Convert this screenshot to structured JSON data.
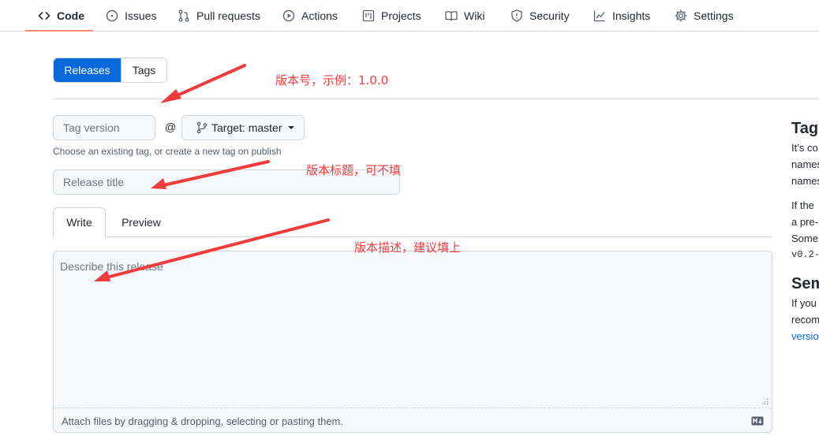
{
  "repo_nav": {
    "items": [
      {
        "id": "code",
        "label": "Code",
        "icon": "code-icon",
        "selected": true
      },
      {
        "id": "issues",
        "label": "Issues",
        "icon": "issue-opened-icon"
      },
      {
        "id": "pulls",
        "label": "Pull requests",
        "icon": "git-pull-request-icon"
      },
      {
        "id": "actions",
        "label": "Actions",
        "icon": "play-icon"
      },
      {
        "id": "projects",
        "label": "Projects",
        "icon": "project-icon"
      },
      {
        "id": "wiki",
        "label": "Wiki",
        "icon": "book-icon"
      },
      {
        "id": "security",
        "label": "Security",
        "icon": "shield-icon"
      },
      {
        "id": "insights",
        "label": "Insights",
        "icon": "graph-icon"
      },
      {
        "id": "settings",
        "label": "Settings",
        "icon": "gear-icon"
      }
    ]
  },
  "subnav": {
    "releases_label": "Releases",
    "tags_label": "Tags"
  },
  "form": {
    "tag_placeholder": "Tag version",
    "at_symbol": "@",
    "target_label": "Target: master",
    "tag_hint": "Choose an existing tag, or create a new tag on publish",
    "title_placeholder": "Release title",
    "write_tab": "Write",
    "preview_tab": "Preview",
    "body_placeholder": "Describe this release",
    "attach_text": "Attach files by dragging & dropping, selecting or pasting them."
  },
  "sidebar": {
    "heading1": "Tagg",
    "para1": [
      "It’s co",
      "names",
      "names"
    ],
    "para2": [
      "If the",
      "a pre-",
      "Some",
      "v0.2-"
    ],
    "heading2": "Sem",
    "para3": [
      "If you",
      "recom",
      "versio"
    ]
  },
  "annotations": {
    "version": "版本号，示例：1.0.0",
    "title": "版本标题，可不填",
    "description": "版本描述，建议填上"
  },
  "colors": {
    "primary": "#0969da",
    "annotation": "#f23b3b",
    "nav_underline": "#fd8c73"
  }
}
